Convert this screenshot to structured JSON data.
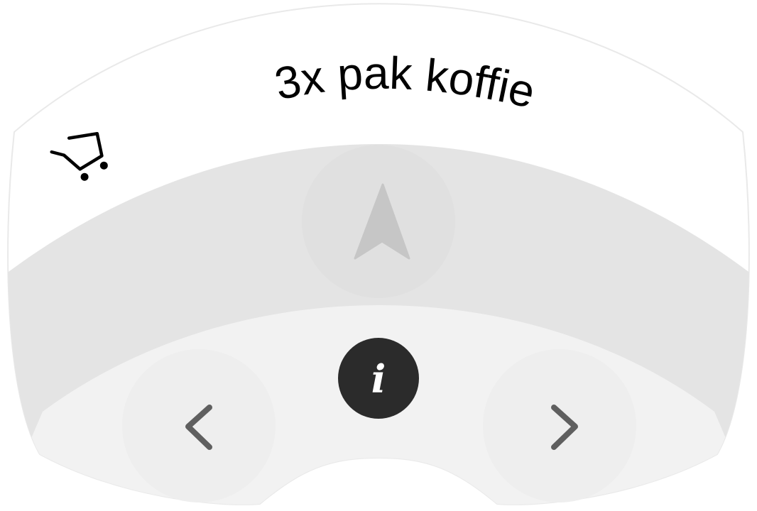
{
  "header": {
    "title": "3x pak koffie",
    "cart_icon": "shopping-cart-icon"
  },
  "controls": {
    "navigate_icon": "navigation-arrow-icon",
    "info_icon": "info-icon",
    "info_glyph": "i",
    "previous_icon": "chevron-left-icon",
    "next_icon": "chevron-right-icon"
  },
  "colors": {
    "outer_band": "#ffffff",
    "middle_band": "#e4e4e4",
    "inner_band": "#f2f2f2",
    "nav_button": "#e0e0e0",
    "nav_arrow": "#c6c6c6",
    "info_button": "#2b2b2b",
    "chevron": "#5f5f5f",
    "title_text": "#000000"
  }
}
